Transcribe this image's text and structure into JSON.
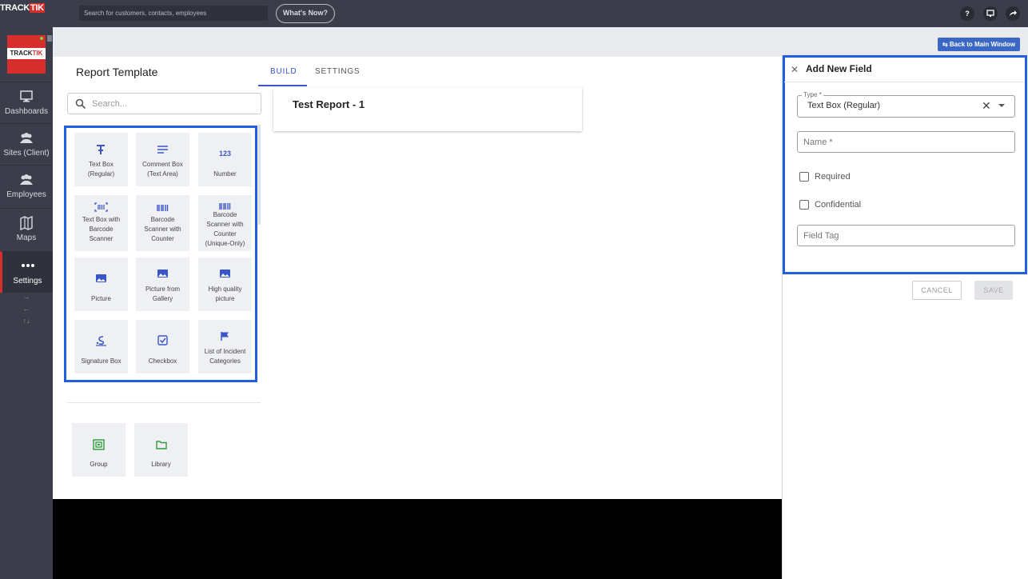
{
  "topbar": {
    "logo_a": "TRACK",
    "logo_b": "TIK",
    "search_placeholder": "Search for customers, contacts, employees",
    "whats_new": "What's Now?",
    "help_icon": "?"
  },
  "sidebar": {
    "logo_a": "TRACK",
    "logo_b": "TIK",
    "items": [
      {
        "label": "Dashboards",
        "icon": "monitor-icon"
      },
      {
        "label": "Sites (Client)",
        "icon": "people-icon"
      },
      {
        "label": "Employees",
        "icon": "people-icon"
      },
      {
        "label": "Maps",
        "icon": "map-icon"
      },
      {
        "label": "Settings",
        "icon": "more-icon"
      }
    ],
    "arrows": [
      "→",
      "←",
      "↑↓"
    ]
  },
  "back_to_main": "Back to Main Window",
  "report_template": {
    "title": "Report Template",
    "tabs": [
      "BUILD",
      "SETTINGS"
    ],
    "search_placeholder": "Search...",
    "fields": [
      {
        "label1": "Text Box",
        "label2": "(Regular)",
        "label3": "",
        "label4": "",
        "icon": "text-icon"
      },
      {
        "label1": "Comment Box",
        "label2": "(Text Area)",
        "label3": "",
        "label4": "",
        "icon": "lines-icon"
      },
      {
        "label1": "Number",
        "label2": "",
        "label3": "",
        "label4": "",
        "icon": "number-icon",
        "icon_text": "123"
      },
      {
        "label1": "Text Box with",
        "label2": "Barcode",
        "label3": "Scanner",
        "label4": "",
        "icon": "barcode-scan-icon"
      },
      {
        "label1": "Barcode",
        "label2": "Scanner with",
        "label3": "Counter",
        "label4": "",
        "icon": "barcode-icon"
      },
      {
        "label1": "Barcode",
        "label2": "Scanner with",
        "label3": "Counter",
        "label4": "(Unique-Only)",
        "icon": "barcode-icon"
      },
      {
        "label1": "Picture",
        "label2": "",
        "label3": "",
        "label4": "",
        "icon": "image-icon"
      },
      {
        "label1": "Picture from",
        "label2": "Gallery",
        "label3": "",
        "label4": "",
        "icon": "image-icon"
      },
      {
        "label1": "High quality",
        "label2": "picture",
        "label3": "",
        "label4": "",
        "icon": "image-icon"
      },
      {
        "label1": "Signature Box",
        "label2": "",
        "label3": "",
        "label4": "",
        "icon": "signature-icon"
      },
      {
        "label1": "Checkbox",
        "label2": "",
        "label3": "",
        "label4": "",
        "icon": "checkbox-icon"
      },
      {
        "label1": "List of Incident",
        "label2": "Categories",
        "label3": "",
        "label4": "",
        "icon": "flag-icon"
      }
    ],
    "containers": [
      {
        "label": "Group",
        "icon": "group-icon"
      },
      {
        "label": "Library",
        "icon": "folder-icon"
      }
    ],
    "report_name": "Test Report - 1"
  },
  "add_field": {
    "title": "Add New Field",
    "type_label": "Type *",
    "type_value": "Text Box (Regular)",
    "name_placeholder": "Name *",
    "required_label": "Required",
    "confidential_label": "Confidential",
    "field_tag_placeholder": "Field Tag",
    "cancel": "CANCEL",
    "save": "SAVE"
  },
  "colors": {
    "accent": "#3a55c8",
    "highlight": "#1f5fe0",
    "brand_red": "#d62d2d",
    "container_green": "#2f9a3a"
  }
}
